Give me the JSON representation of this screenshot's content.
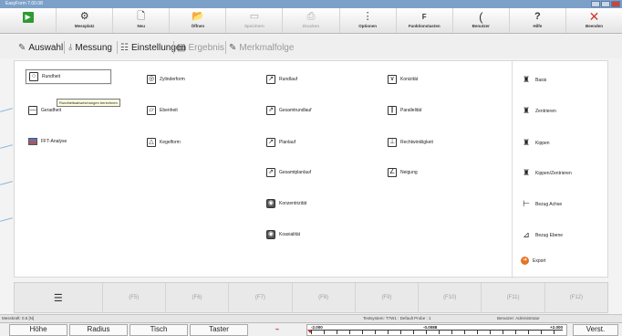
{
  "window": {
    "title": "EasyForm 7.00.08"
  },
  "ribbon": [
    {
      "label": "",
      "icon": "play-icon",
      "disabled": false
    },
    {
      "label": "Messplatz",
      "icon": "measurement-station-icon",
      "disabled": false
    },
    {
      "label": "Neu",
      "icon": "new-document-icon",
      "disabled": false
    },
    {
      "label": "Öffnen",
      "icon": "open-folder-icon",
      "disabled": false
    },
    {
      "label": "Speichern",
      "icon": "save-icon",
      "disabled": true
    },
    {
      "label": "Drucken",
      "icon": "print-icon",
      "disabled": true
    },
    {
      "label": "Optionen",
      "icon": "options-icon",
      "disabled": false
    },
    {
      "label": "Funktionstasten",
      "icon": "function-keys-icon",
      "disabled": false
    },
    {
      "label": "Benutzer",
      "icon": "user-icon",
      "disabled": false
    },
    {
      "label": "Hilfe",
      "icon": "help-icon",
      "disabled": false
    },
    {
      "label": "Beenden",
      "icon": "close-icon",
      "disabled": false
    }
  ],
  "tabs": {
    "auswahl": "Auswahl",
    "messung": "Messung",
    "einstellungen": "Einstellungen",
    "ergebnis": "Ergebnis",
    "merkmalfolge": "Merkmalfolge"
  },
  "characteristics": {
    "col1": [
      "Rundheit",
      "Geradheit",
      "FFT-Analyse"
    ],
    "col2": [
      "Zylinderform",
      "Ebenheit",
      "Kegelform"
    ],
    "col3": [
      "Rundlauf",
      "Gesamtrundlauf",
      "Planlauf",
      "Gesamtplanlauf",
      "Konzentrizität",
      "Koaxialität"
    ],
    "col4": [
      "Konizität",
      "Parallelität",
      "Rechtwinkligkeit",
      "Neigung"
    ],
    "right": [
      "Basis",
      "Zentrieren",
      "Kippen",
      "Kippen/Zentrieren",
      "Bezug Achse",
      "Bezug Ebene",
      "Export"
    ]
  },
  "tooltip": "Rundheitsabweichungen berechnen",
  "fkeys": [
    "(F5)",
    "(F6)",
    "(F7)",
    "(F8)",
    "(F9)",
    "(F10)",
    "(F11)",
    "(F12)"
  ],
  "status": {
    "unit": "Messkraft: 0.5 [N]",
    "system": "Testsystem: T7W1 : Default Probe : 1",
    "user": "Benutzer: Administrator"
  },
  "bottom": {
    "hoehe": "Höhe",
    "radius": "Radius",
    "tisch": "Tisch",
    "taster": "Taster",
    "gauge_min": "-2.000",
    "gauge_mid": "-0.0088",
    "gauge_max": "+2.000",
    "verst": "Verst."
  }
}
